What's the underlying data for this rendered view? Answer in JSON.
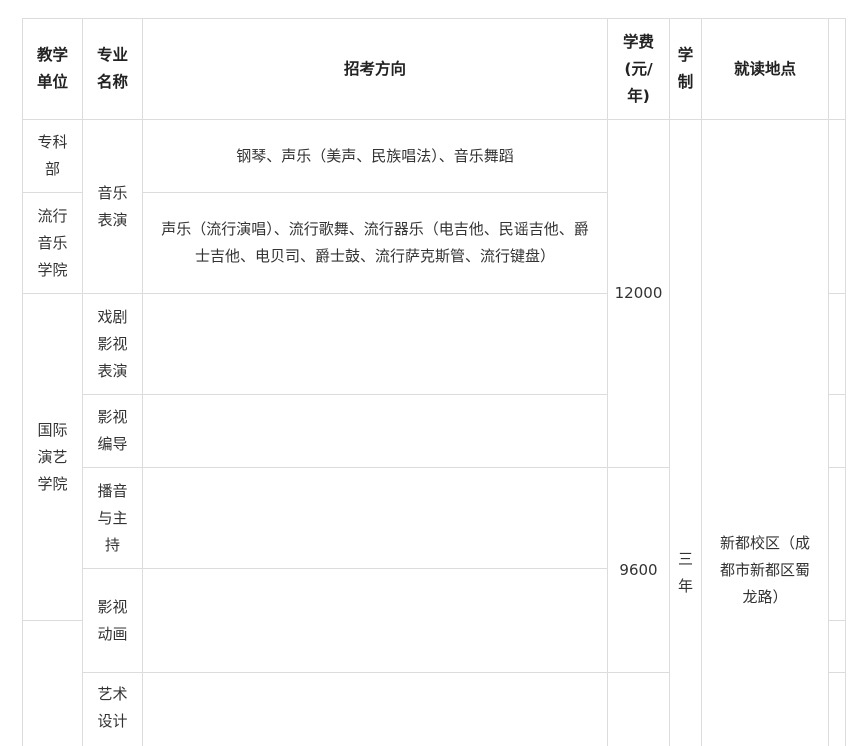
{
  "headers": {
    "unit": "教学单位",
    "major": "专业名称",
    "direction": "招考方向",
    "fee": "学费(元/年)",
    "duration": "学制",
    "location": "就读地点"
  },
  "units": {
    "u1": "专科部",
    "u2": "流行音乐学院",
    "u3": "国际演艺学院"
  },
  "majors": {
    "m1": "音乐表演",
    "m2": "戏剧影视表演",
    "m3": "影视编导",
    "m4": "播音与主持",
    "m5": "影视动画",
    "m6": "艺术设计"
  },
  "directions": {
    "d1": "钢琴、声乐（美声、民族唱法）、音乐舞蹈",
    "d2": "声乐（流行演唱）、流行歌舞、流行器乐（电吉他、民谣吉他、爵士吉他、电贝司、爵士鼓、流行萨克斯管、流行键盘）"
  },
  "fees": {
    "f1": "12000",
    "f2": "9600"
  },
  "duration": "三年",
  "location": "新都校区（成都市新都区蜀龙路）"
}
